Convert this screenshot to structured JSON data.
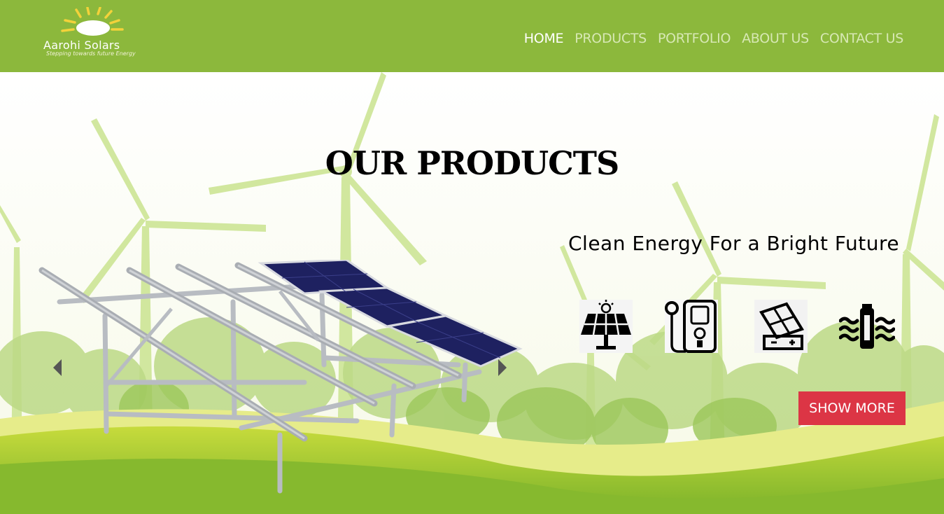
{
  "brand": {
    "name": "Aarohi Solars",
    "tagline": "Stepping towards future Energy"
  },
  "nav": {
    "items": [
      "HOME",
      "PRODUCTS",
      "PORTFOLIO",
      "ABOUT US",
      "CONTACT US"
    ],
    "active": "HOME"
  },
  "hero": {
    "title": "OUR PRODUCTS",
    "tagline": "Clean Energy For a Bright Future",
    "button": "SHOW MORE",
    "icons": [
      "solar-panel-icon",
      "water-heater-icon",
      "solar-battery-icon",
      "solar-pump-icon"
    ]
  },
  "colors": {
    "header_bg": "#8cb83c",
    "button_bg": "#dc3545",
    "nav_active": "#ffffff",
    "nav_inactive": "#d7e8b4"
  }
}
